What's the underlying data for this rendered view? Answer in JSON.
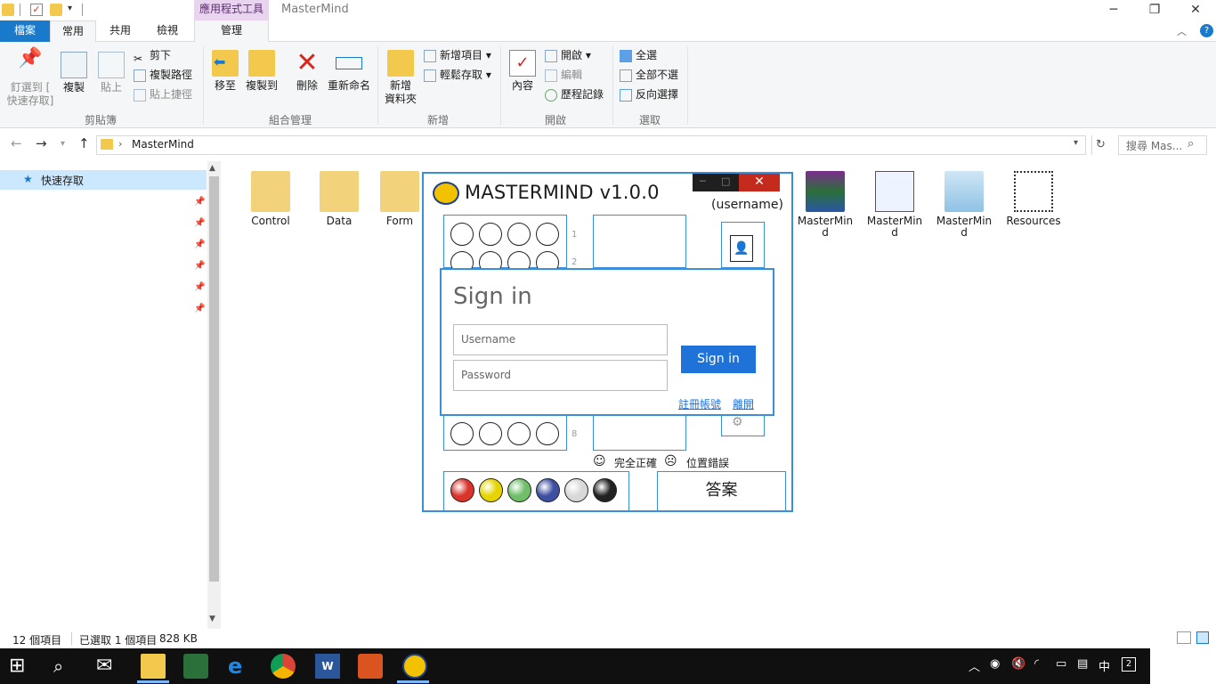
{
  "window": {
    "title": "MasterMind",
    "context_tab_label": "應用程式工具"
  },
  "ribbon": {
    "tabs": {
      "file": "檔案",
      "home": "常用",
      "share": "共用",
      "view": "檢視",
      "manage": "管理"
    },
    "clipboard": {
      "pin_label_1": "釘選到 [",
      "pin_label_2": "快速存取]",
      "copy": "複製",
      "paste": "貼上",
      "cut": "剪下",
      "copy_path": "複製路徑",
      "paste_shortcut": "貼上捷徑",
      "group": "剪貼簿"
    },
    "organize": {
      "move_to": "移至",
      "copy_to": "複製到",
      "delete": "刪除",
      "rename": "重新命名",
      "group": "組合管理"
    },
    "new": {
      "new_folder_1": "新增",
      "new_folder_2": "資料夾",
      "new_item": "新增項目",
      "easy_access": "輕鬆存取",
      "group": "新增"
    },
    "open": {
      "properties": "內容",
      "open": "開啟",
      "edit": "編輯",
      "history": "歷程記錄",
      "group": "開啟"
    },
    "select": {
      "select_all": "全選",
      "select_none": "全部不選",
      "invert": "反向選擇",
      "group": "選取"
    }
  },
  "address": {
    "path": "MasterMind",
    "search_placeholder": "搜尋 Mas..."
  },
  "navpane": {
    "quick_access": "快速存取"
  },
  "files": [
    {
      "name": "Control"
    },
    {
      "name": "Data"
    },
    {
      "name": "Form"
    },
    {
      "name": "MasterMin\nd"
    },
    {
      "name": "MasterMin\nd"
    },
    {
      "name": "MasterMin\nd"
    },
    {
      "name": "Resources"
    }
  ],
  "status": {
    "count": "12 個項目",
    "selected": "已選取 1 個項目",
    "size": "828 KB"
  },
  "taskbar": {
    "ime": "中",
    "tray_badge": "2"
  },
  "mastermind": {
    "title": "MASTERMIND v1.0.0",
    "username": "(username)",
    "row_numbers": [
      "1",
      "2",
      "8"
    ],
    "legend_correct": "完全正確",
    "legend_position": "位置錯誤",
    "answer_button": "答案",
    "colors": [
      "#d9332b",
      "#e6d400",
      "#6fbf6a",
      "#3c4fa0",
      "#d8d8d8",
      "#222222"
    ]
  },
  "signin": {
    "title": "Sign in",
    "username_placeholder": "Username",
    "password_placeholder": "Password",
    "button": "Sign in",
    "register_link": "註冊帳號",
    "leave_link": "離開"
  }
}
